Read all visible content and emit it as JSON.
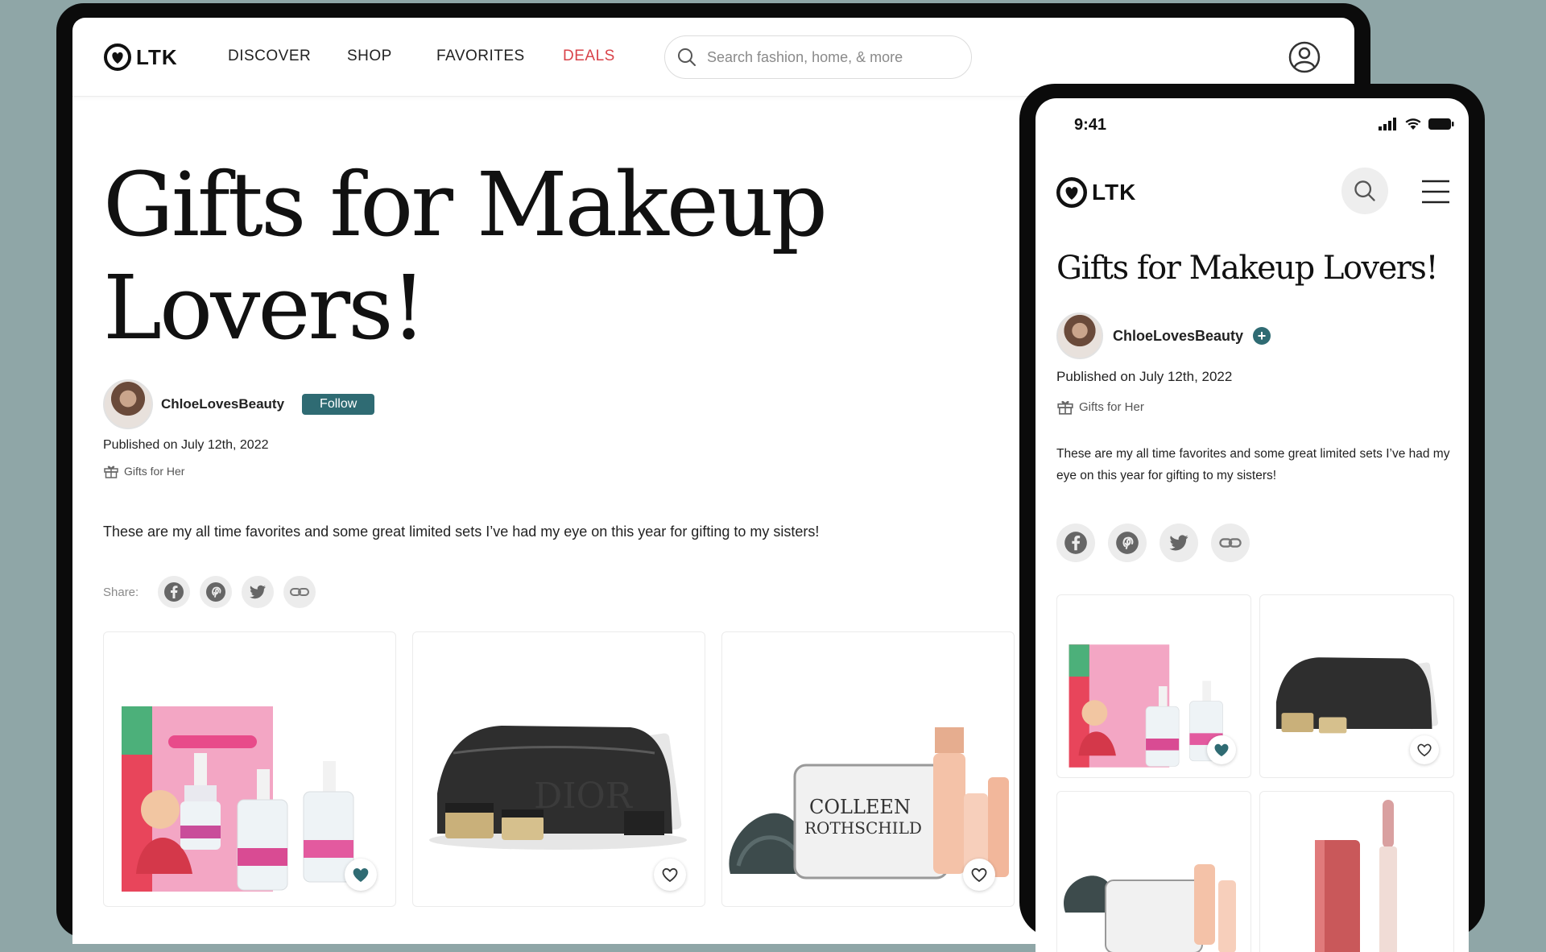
{
  "desktop": {
    "nav": {
      "logo": "LTK",
      "links": [
        "DISCOVER",
        "SHOP",
        "FAVORITES",
        "DEALS"
      ],
      "search_placeholder": "Search fashion, home, & more"
    },
    "title": "Gifts for Makeup Lovers!",
    "author": {
      "name": "ChloeLovesBeauty",
      "follow_label": "Follow"
    },
    "published": "Published on July 12th, 2022",
    "tag": "Gifts for Her",
    "description": "These are my all time favorites and some great limited sets I’ve had my eye on this year for gifting to my sisters!",
    "share_label": "Share:",
    "share_icons": [
      "facebook-icon",
      "pinterest-icon",
      "twitter-icon",
      "link-icon"
    ],
    "products": [
      {
        "name": "it cosmetics bye bye lines serum set",
        "favorited": true
      },
      {
        "name": "dior black pouch makeup set",
        "favorited": false
      },
      {
        "name": "colleen rothschild beauty bag set",
        "favorited": false
      }
    ]
  },
  "mobile": {
    "status_time": "9:41",
    "logo": "LTK",
    "title": "Gifts for Makeup Lovers!",
    "author": {
      "name": "ChloeLovesBeauty",
      "follow_symbol": "+"
    },
    "published": "Published on July 12th, 2022",
    "tag": "Gifts for Her",
    "description": "These are my all time favorites and some great limited sets I’ve had my eye on this year for gifting to my sisters!",
    "products": [
      {
        "name": "it cosmetics serum set",
        "favorited": true
      },
      {
        "name": "dior black pouch set",
        "favorited": false
      },
      {
        "name": "colleen rothschild bag set",
        "favorited": false
      },
      {
        "name": "lip gloss",
        "favorited": false
      }
    ]
  },
  "colors": {
    "background": "#8fa6a7",
    "accent": "#2f6b73",
    "deals": "#d9434a"
  }
}
